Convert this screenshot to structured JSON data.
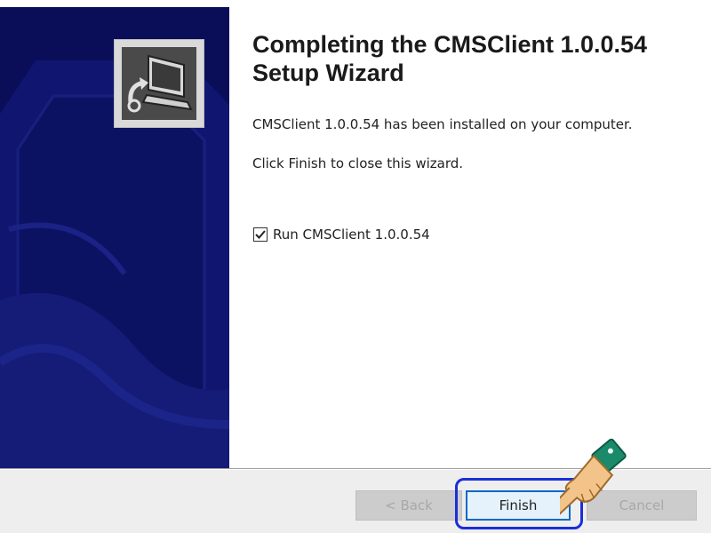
{
  "wizard": {
    "title": "Completing the CMSClient 1.0.0.54 Setup Wizard",
    "title_line1": "Completing the CMSClient 1.0.0.54",
    "title_line2": "Setup Wizard",
    "installed_message": "CMSClient 1.0.0.54 has been installed on your computer.",
    "finish_message": "Click Finish to close this wizard.",
    "run_checkbox": {
      "label": "Run CMSClient 1.0.0.54",
      "checked": true
    }
  },
  "buttons": {
    "back_label": "< Back",
    "finish_label": "Finish",
    "cancel_label": "Cancel"
  },
  "icons": {
    "logo": "installer-computer-icon",
    "pointer": "hand-pointer-icon"
  },
  "colors": {
    "banner": "#0a0e58",
    "highlight": "#1a2fd8",
    "finish_border": "#0a68c8"
  }
}
